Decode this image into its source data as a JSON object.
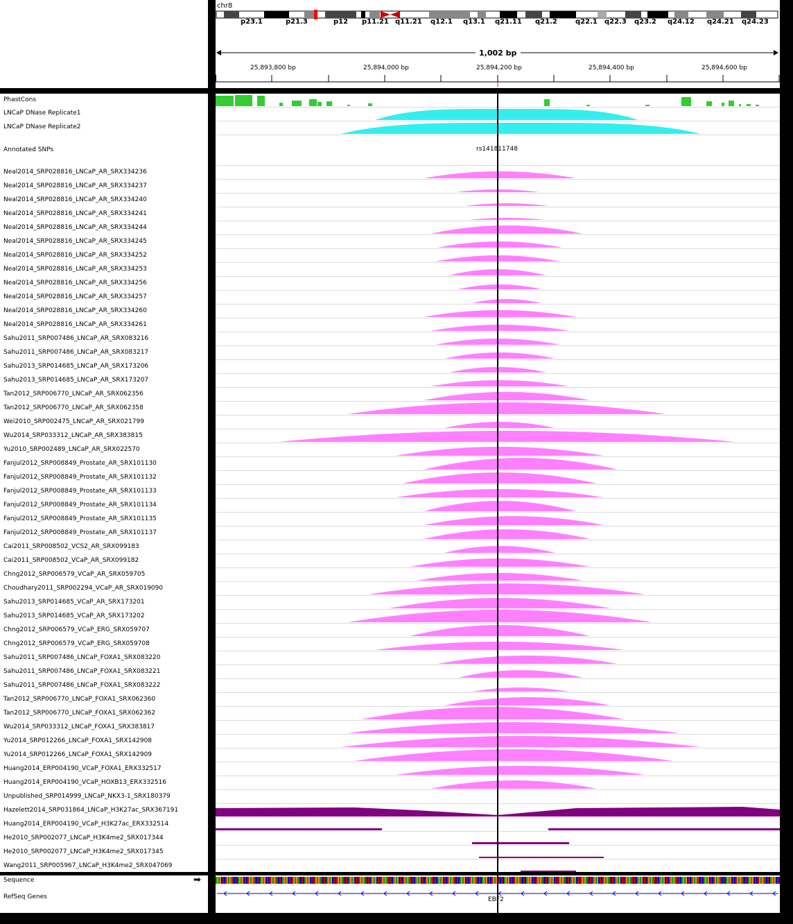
{
  "app": {
    "name": "IGV genome browser"
  },
  "colors": {
    "phastcons": "#33cc33",
    "dnase": "#33eeee",
    "chip": "#ff80ff",
    "histone": "#800080",
    "strand": "#0000cc",
    "locus_line": "#000000",
    "center_tick": "#ff0000"
  },
  "ideogram": {
    "chromosome": "chr8",
    "bands": [
      "p23.1",
      "p21.3",
      "p12",
      "p11.21",
      "q11.21",
      "q12.1",
      "q13.1",
      "q21.11",
      "q21.2",
      "q22.1",
      "q22.3",
      "q23.2",
      "q24.12",
      "q24.21",
      "q24.23"
    ]
  },
  "ruler": {
    "span_label": "1,002 bp",
    "ticks": [
      "25,893,800 bp",
      "25,894,000 bp",
      "25,894,200 bp",
      "25,894,400 bp",
      "25,894,600 bp"
    ]
  },
  "tracks": {
    "phastcons": "PhastCons",
    "dnase1": "LNCaP DNase Replicate1",
    "dnase2": "LNCaP DNase Replicate2",
    "snps": "Annotated SNPs",
    "snp_label": "rs141811748",
    "chip": [
      "Neal2014_SRP028816_LNCaP_AR_SRX334236",
      "Neal2014_SRP028816_LNCaP_AR_SRX334237",
      "Neal2014_SRP028816_LNCaP_AR_SRX334240",
      "Neal2014_SRP028816_LNCaP_AR_SRX334241",
      "Neal2014_SRP028816_LNCaP_AR_SRX334244",
      "Neal2014_SRP028816_LNCaP_AR_SRX334245",
      "Neal2014_SRP028816_LNCaP_AR_SRX334252",
      "Neal2014_SRP028816_LNCaP_AR_SRX334253",
      "Neal2014_SRP028816_LNCaP_AR_SRX334256",
      "Neal2014_SRP028816_LNCaP_AR_SRX334257",
      "Neal2014_SRP028816_LNCaP_AR_SRX334260",
      "Neal2014_SRP028816_LNCaP_AR_SRX334261",
      "Sahu2011_SRP007486_LNCaP_AR_SRX083216",
      "Sahu2011_SRP007486_LNCaP_AR_SRX083217",
      "Sahu2013_SRP014685_LNCaP_AR_SRX173206",
      "Sahu2013_SRP014685_LNCaP_AR_SRX173207",
      "Tan2012_SRP006770_LNCaP_AR_SRX062356",
      "Tan2012_SRP006770_LNCaP_AR_SRX062358",
      "Wei2010_SRP002475_LNCaP_AR_SRX021799",
      "Wu2014_SRP033312_LNCaP_AR_SRX383815",
      "Yu2010_SRP002489_LNCaP_AR_SRX022570",
      "Fanjul2012_SRP008849_Prostate_AR_SRX101130",
      "Fanjul2012_SRP008849_Prostate_AR_SRX101132",
      "Fanjul2012_SRP008849_Prostate_AR_SRX101133",
      "Fanjul2012_SRP008849_Prostate_AR_SRX101134",
      "Fanjul2012_SRP008849_Prostate_AR_SRX101135",
      "Fanjul2012_SRP008849_Prostate_AR_SRX101137",
      "Cai2011_SRP008502_VCS2_AR_SRX099183",
      "Cai2011_SRP008502_VCaP_AR_SRX099182",
      "Chng2012_SRP006579_VCaP_AR_SRX059705",
      "Choudhary2011_SRP002294_VCaP_AR_SRX019090",
      "Sahu2013_SRP014685_VCaP_AR_SRX173201",
      "Sahu2013_SRP014685_VCaP_AR_SRX173202",
      "Chng2012_SRP006579_VCaP_ERG_SRX059707",
      "Chng2012_SRP006579_VCaP_ERG_SRX059708",
      "Sahu2011_SRP007486_LNCaP_FOXA1_SRX083220",
      "Sahu2011_SRP007486_LNCaP_FOXA1_SRX083221",
      "Sahu2011_SRP007486_LNCaP_FOXA1_SRX083222",
      "Tan2012_SRP006770_LNCaP_FOXA1_SRX062360",
      "Tan2012_SRP006770_LNCaP_FOXA1_SRX062362",
      "Wu2014_SRP033312_LNCaP_FOXA1_SRX383817",
      "Yu2014_SRP012266_LNCaP_FOXA1_SRX142908",
      "Yu2014_SRP012266_LNCaP_FOXA1_SRX142909",
      "Huang2014_ERP004190_VCaP_FOXA1_ERX332517",
      "Huang2014_ERP004190_VCaP_HOXB13_ERX332516",
      "Unpublished_SRP014999_LNCaP_NKX3-1_SRX180379",
      "Hazelett2014_SRP031864_LNCaP_H3K27ac_SRX367191",
      "Huang2014_ERP004190_VCaP_H3K27ac_ERX332514",
      "He2010_SRP002077_LNCaP_H3K4me2_SRX017344",
      "He2010_SRP002077_LNCaP_H3K4me2_SRX017345",
      "Wang2011_SRP005967_LNCaP_H3K4me2_SRX047069"
    ],
    "sequence": "Sequence",
    "refseq": "RefSeq Genes",
    "gene_name": "EBF2"
  }
}
